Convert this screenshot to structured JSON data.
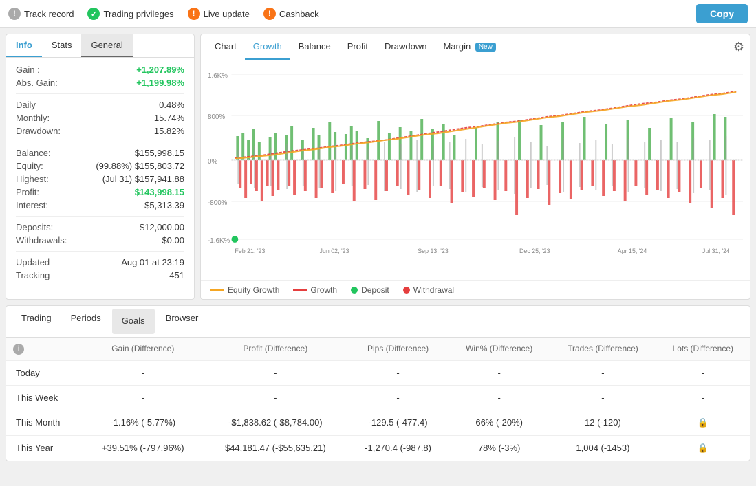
{
  "topnav": {
    "items": [
      {
        "label": "Track record",
        "icon_type": "gray",
        "icon_symbol": "!"
      },
      {
        "label": "Trading privileges",
        "icon_type": "green",
        "icon_symbol": "✓"
      },
      {
        "label": "Live update",
        "icon_type": "orange",
        "icon_symbol": "!"
      },
      {
        "label": "Cashback",
        "icon_type": "orange",
        "icon_symbol": "!"
      }
    ],
    "copy_label": "Copy"
  },
  "left_panel": {
    "tabs": [
      {
        "label": "Info",
        "active": true
      },
      {
        "label": "Stats",
        "active": false
      },
      {
        "label": "General",
        "active_gray": true
      }
    ],
    "info": {
      "gain_label": "Gain :",
      "gain_value": "+1,207.89%",
      "abs_gain_label": "Abs. Gain:",
      "abs_gain_value": "+1,199.98%",
      "daily_label": "Daily",
      "daily_value": "0.48%",
      "monthly_label": "Monthly:",
      "monthly_value": "15.74%",
      "drawdown_label": "Drawdown:",
      "drawdown_value": "15.82%",
      "balance_label": "Balance:",
      "balance_value": "$155,998.15",
      "equity_label": "Equity:",
      "equity_value": "(99.88%) $155,803.72",
      "highest_label": "Highest:",
      "highest_value": "(Jul 31) $157,941.88",
      "profit_label": "Profit:",
      "profit_value": "$143,998.15",
      "interest_label": "Interest:",
      "interest_value": "-$5,313.39",
      "deposits_label": "Deposits:",
      "deposits_value": "$12,000.00",
      "withdrawals_label": "Withdrawals:",
      "withdrawals_value": "$0.00",
      "updated_label": "Updated",
      "updated_value": "Aug 01 at 23:19",
      "tracking_label": "Tracking",
      "tracking_value": "451"
    }
  },
  "chart_panel": {
    "tabs": [
      {
        "label": "Chart",
        "active": false
      },
      {
        "label": "Growth",
        "active": true
      },
      {
        "label": "Balance",
        "active": false
      },
      {
        "label": "Profit",
        "active": false
      },
      {
        "label": "Drawdown",
        "active": false
      },
      {
        "label": "Margin",
        "active": false,
        "badge": "New"
      }
    ],
    "y_labels": [
      "1.6K%",
      "800%",
      "0%",
      "-800%",
      "-1.6K%"
    ],
    "x_labels": [
      "Feb 21, '23",
      "Jun 02, '23",
      "Sep 13, '23",
      "Dec 25, '23",
      "Apr 15, '24",
      "Jul 31, '24"
    ],
    "legend": [
      {
        "label": "Equity Growth",
        "type": "line",
        "color": "#f5a623"
      },
      {
        "label": "Growth",
        "type": "line-dashed",
        "color": "#e53e3e"
      },
      {
        "label": "Deposit",
        "type": "dot",
        "color": "#22c55e"
      },
      {
        "label": "Withdrawal",
        "type": "dot",
        "color": "#e53e3e"
      }
    ]
  },
  "bottom_panel": {
    "tabs": [
      {
        "label": "Trading",
        "active": false
      },
      {
        "label": "Periods",
        "active": false
      },
      {
        "label": "Goals",
        "active_gray": true
      },
      {
        "label": "Browser",
        "active": false
      }
    ],
    "table": {
      "headers": [
        "",
        "Gain (Difference)",
        "Profit (Difference)",
        "Pips (Difference)",
        "Win% (Difference)",
        "Trades (Difference)",
        "Lots (Difference)"
      ],
      "rows": [
        {
          "period": "Today",
          "gain": "-",
          "profit": "-",
          "pips": "-",
          "win": "-",
          "trades": "-",
          "lots": "-",
          "gain_color": "neutral",
          "profit_color": "neutral",
          "pips_color": "neutral"
        },
        {
          "period": "This Week",
          "gain": "-",
          "profit": "-",
          "pips": "-",
          "win": "-",
          "trades": "-",
          "lots": "-",
          "gain_color": "neutral",
          "profit_color": "neutral",
          "pips_color": "neutral"
        },
        {
          "period": "This Month",
          "gain": "-1.16% (-5.77%)",
          "profit": "-$1,838.62 (-$8,784.00)",
          "pips": "-129.5 (-477.4)",
          "win": "66% (-20%)",
          "trades": "12 (-120)",
          "lots": "🔒",
          "gain_color": "red",
          "profit_color": "red",
          "pips_color": "red"
        },
        {
          "period": "This Year",
          "gain": "+39.51% (-797.96%)",
          "profit": "$44,181.47 (-$55,635.21)",
          "pips": "-1,270.4 (-987.8)",
          "win": "78% (-3%)",
          "trades": "1,004 (-1453)",
          "lots": "🔒",
          "gain_color": "green",
          "profit_color": "green",
          "pips_color": "red"
        }
      ]
    }
  }
}
